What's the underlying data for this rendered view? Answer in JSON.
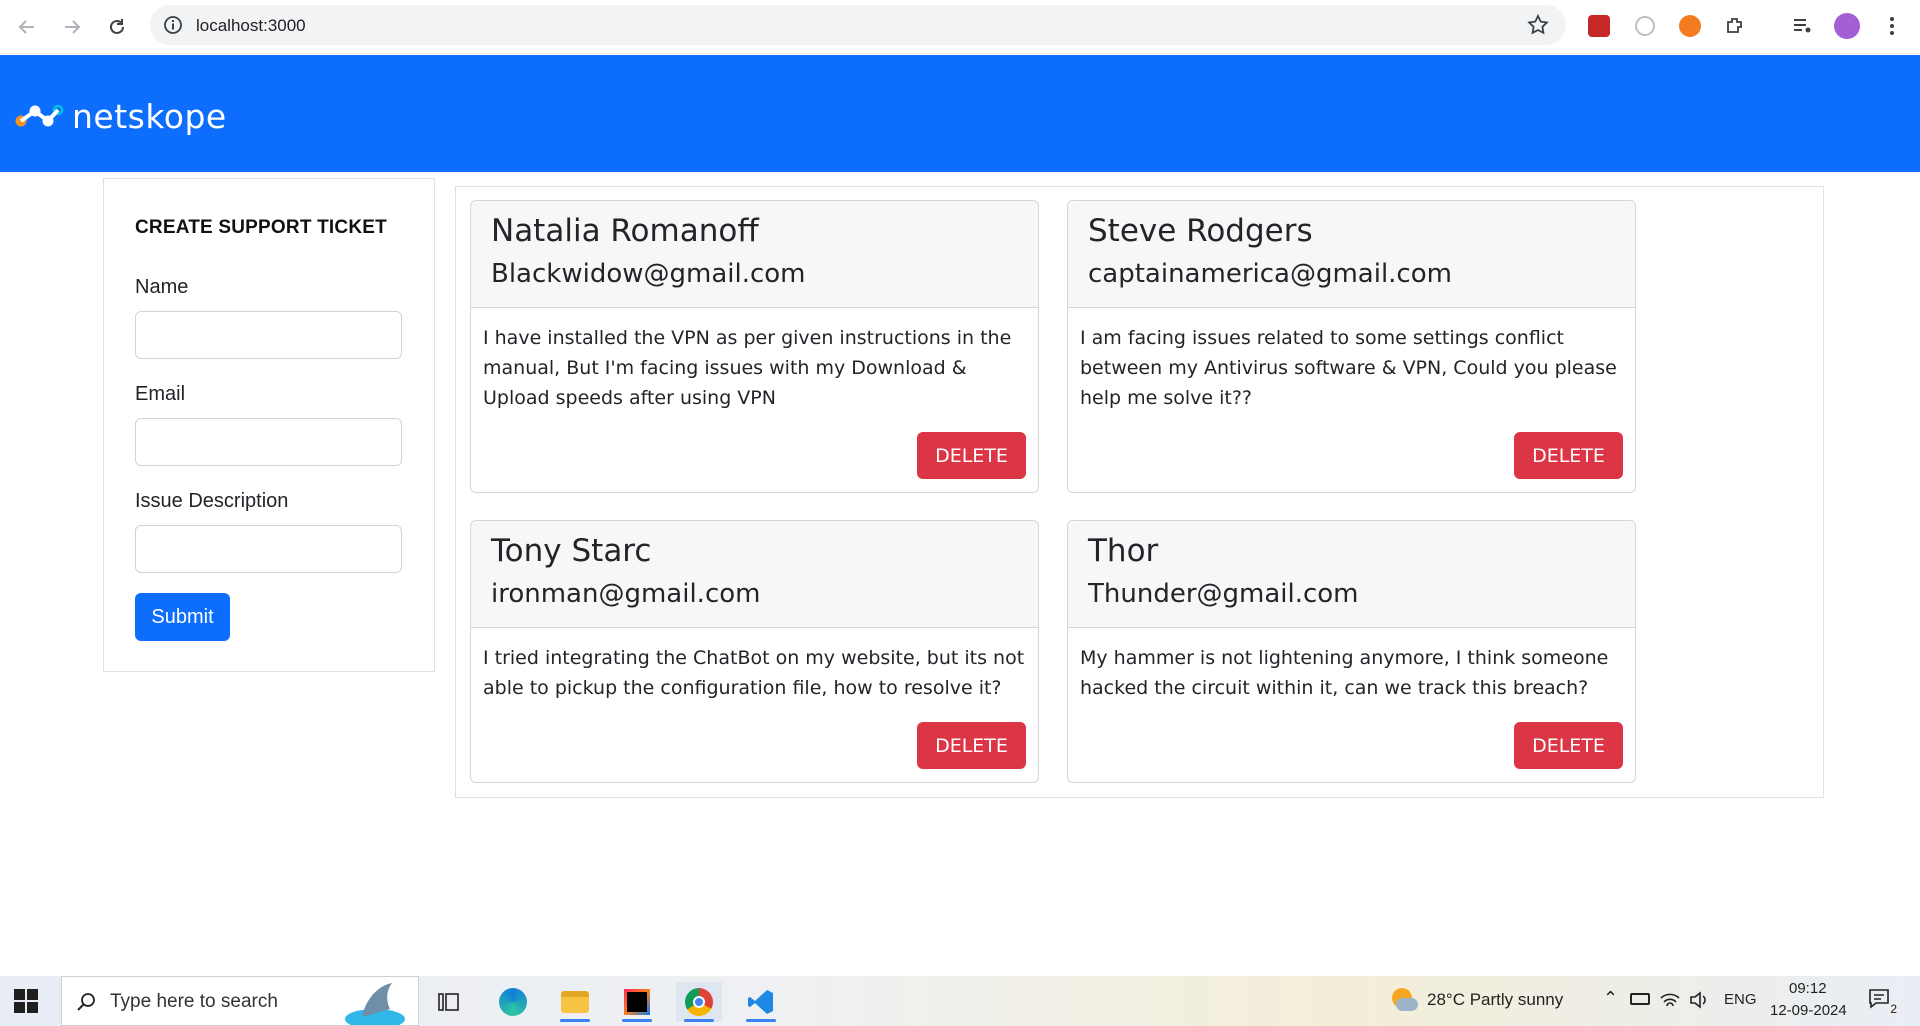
{
  "browser": {
    "url": "localhost:3000"
  },
  "app": {
    "logo_text": "netskope"
  },
  "form": {
    "title": "CREATE SUPPORT TICKET",
    "name_label": "Name",
    "name_value": "",
    "email_label": "Email",
    "email_value": "",
    "issue_label": "Issue Description",
    "issue_value": "",
    "submit_label": "Submit"
  },
  "tickets": [
    {
      "name": "Natalia Romanoff",
      "email": "Blackwidow@gmail.com",
      "description": "I have installed the VPN as per given instructions in the manual, But I'm facing issues with my Download & Upload speeds after using VPN",
      "delete_label": "DELETE"
    },
    {
      "name": "Steve Rodgers",
      "email": "captainamerica@gmail.com",
      "description": "I am facing issues related to some settings conflict between my Antivirus software & VPN, Could you please help me solve it??",
      "delete_label": "DELETE"
    },
    {
      "name": "Tony Starc",
      "email": "ironman@gmail.com",
      "description": "I tried integrating the ChatBot on my website, but its not able to pickup the configuration file, how to resolve it?",
      "delete_label": "DELETE"
    },
    {
      "name": "Thor",
      "email": "Thunder@gmail.com",
      "description": "My hammer is not lightening anymore, I think someone hacked the circuit within it, can we track this breach?",
      "delete_label": "DELETE"
    }
  ],
  "taskbar": {
    "search_placeholder": "Type here to search",
    "weather": "28°C  Partly sunny",
    "language": "ENG",
    "time": "09:12",
    "date": "12-09-2024",
    "notification_count": "2"
  },
  "colors": {
    "header": "#0d6efd",
    "primary": "#0d6efd",
    "danger": "#dc3545"
  }
}
